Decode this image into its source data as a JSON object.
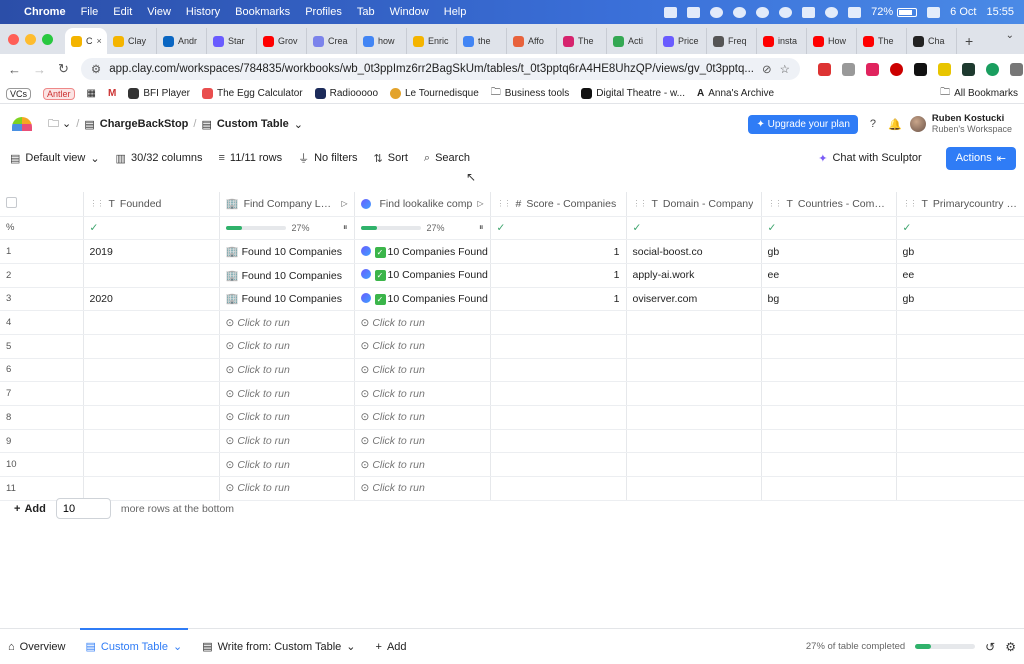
{
  "menubar": {
    "app": "Chrome",
    "items": [
      "File",
      "Edit",
      "View",
      "History",
      "Bookmarks",
      "Profiles",
      "Tab",
      "Window",
      "Help"
    ],
    "battery": "72%",
    "date": "6 Oct",
    "time": "15:55"
  },
  "tabs": [
    {
      "label": "C",
      "color": "#f4b400",
      "active": true
    },
    {
      "label": "Clay",
      "color": "#f4b400"
    },
    {
      "label": "Andr",
      "color": "#0a66c2"
    },
    {
      "label": "Star",
      "color": "#6a5cff"
    },
    {
      "label": "Grov",
      "color": "#ff0000"
    },
    {
      "label": "Crea",
      "color": "#7b83eb"
    },
    {
      "label": "how",
      "color": "#4285f4"
    },
    {
      "label": "Enric",
      "color": "#f4b400"
    },
    {
      "label": "the",
      "color": "#4285f4"
    },
    {
      "label": "Affo",
      "color": "#e8623c"
    },
    {
      "label": "The",
      "color": "#d6246e"
    },
    {
      "label": "Acti",
      "color": "#34a853"
    },
    {
      "label": "Price",
      "color": "#6a5cff"
    },
    {
      "label": "Freq",
      "color": "#555555"
    },
    {
      "label": "insta",
      "color": "#ff0000"
    },
    {
      "label": "How",
      "color": "#ff0000"
    },
    {
      "label": "The",
      "color": "#ff0000"
    },
    {
      "label": "Cha",
      "color": "#222222"
    }
  ],
  "address": {
    "url": "app.clay.com/workspaces/784835/workbooks/wb_0t3ppImz6rr2BagSkUm/tables/t_0t3pptq6rA4HE8UhzQP/views/gv_0t3pptq..."
  },
  "bookmarks": [
    "VCs",
    "Antler",
    "BFI Player",
    "The Egg Calculator",
    "Radiooooo",
    "Le Tournedisque",
    "Business tools",
    "Digital Theatre - w...",
    "Anna's Archive",
    "All Bookmarks"
  ],
  "header": {
    "workbook": "ChargeBackStop",
    "view": "Custom Table",
    "upgrade": "Upgrade your plan",
    "user_name": "Ruben Kostucki",
    "user_workspace": "Ruben's Workspace"
  },
  "toolbar": {
    "view": "Default view",
    "columns": "30/32 columns",
    "rows": "11/11 rows",
    "filters": "No filters",
    "sort": "Sort",
    "search": "Search",
    "sculptor": "Chat with Sculptor",
    "actions": "Actions"
  },
  "table": {
    "columns": [
      "Founded",
      "Find Company Looka",
      "Find lookalike comp",
      "Score - Companies",
      "Domain - Company",
      "Countries - Compan",
      "Primarycountry - Co"
    ],
    "percent_row": {
      "label": "%",
      "progress1": "27%",
      "progress2": "27%",
      "progress_fraction": 0.27
    },
    "rows": [
      {
        "n": "1",
        "founded": "2019",
        "find": "Found 10 Companies",
        "lookalike": "10 Companies Found",
        "score": "1",
        "domain": "social-boost.co",
        "countries": "gb",
        "primary": "gb"
      },
      {
        "n": "2",
        "founded": "",
        "find": "Found 10 Companies",
        "lookalike": "10 Companies Found",
        "score": "1",
        "domain": "apply-ai.work",
        "countries": "ee",
        "primary": "ee"
      },
      {
        "n": "3",
        "founded": "2020",
        "find": "Found 10 Companies",
        "lookalike": "10 Companies Found",
        "score": "1",
        "domain": "oviserver.com",
        "countries": "bg",
        "primary": "gb"
      },
      {
        "n": "4"
      },
      {
        "n": "5"
      },
      {
        "n": "6"
      },
      {
        "n": "7"
      },
      {
        "n": "8"
      },
      {
        "n": "9"
      },
      {
        "n": "10"
      },
      {
        "n": "11"
      }
    ],
    "click_to_run": "Click to run"
  },
  "addrows": {
    "button": "Add",
    "value": "10",
    "hint": "more rows at the bottom"
  },
  "footer": {
    "overview": "Overview",
    "custom_table": "Custom Table",
    "write_from": "Write from: Custom Table",
    "add": "Add",
    "completed": "27% of table completed",
    "completed_fraction": 0.27
  }
}
